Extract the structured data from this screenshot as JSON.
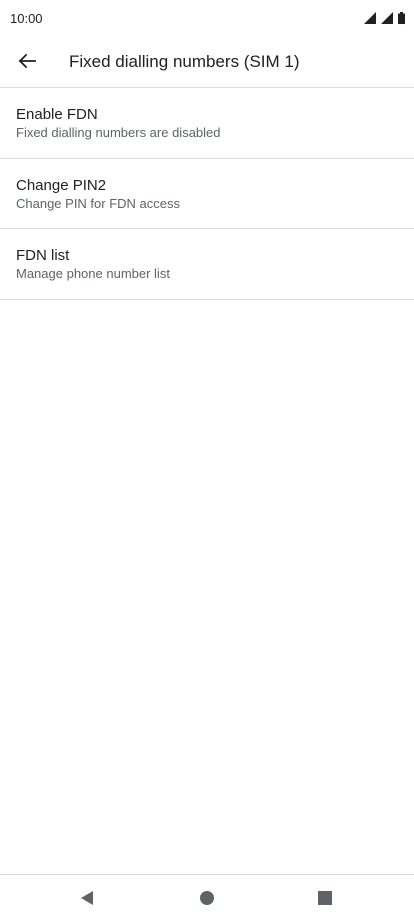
{
  "status_bar": {
    "time": "10:00",
    "icons": [
      "signal-icon",
      "signal-icon",
      "battery-icon"
    ]
  },
  "app_bar": {
    "back_icon": "arrow-left-icon",
    "title": "Fixed dialling numbers (SIM 1)"
  },
  "settings": {
    "items": [
      {
        "title": "Enable FDN",
        "subtitle": "Fixed dialling numbers are disabled"
      },
      {
        "title": "Change PIN2",
        "subtitle": "Change PIN for FDN access"
      },
      {
        "title": "FDN list",
        "subtitle": "Manage phone number list"
      }
    ]
  },
  "nav_bar": {
    "icons": [
      "back-triangle-icon",
      "home-circle-icon",
      "recents-square-icon"
    ]
  },
  "colors": {
    "text_primary": "#202124",
    "text_secondary": "#5f6368",
    "divider": "#dadce0"
  }
}
